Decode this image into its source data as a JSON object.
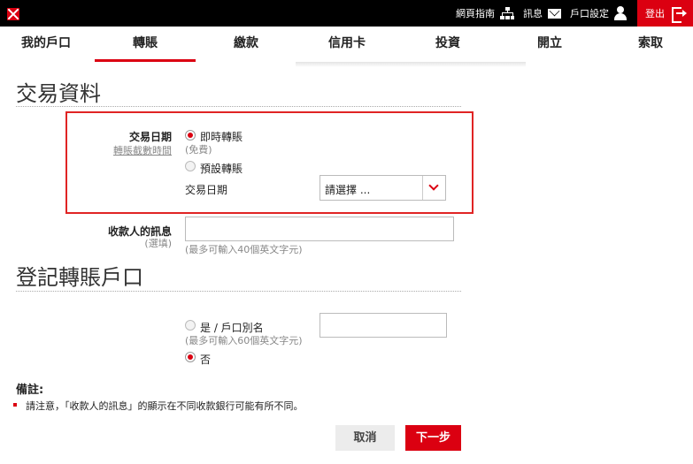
{
  "topbar": {
    "guide": "網頁指南",
    "messages": "訊息",
    "settings": "戶口設定",
    "logout": "登出"
  },
  "nav": {
    "items": [
      "我的戶口",
      "轉賬",
      "繳款",
      "信用卡",
      "投資",
      "開立",
      "索取"
    ],
    "active": "轉賬"
  },
  "transaction": {
    "title": "交易資料",
    "date_label": "交易日期",
    "cutoff_link": "轉賬截數時間",
    "instant_label": "即時轉賬",
    "instant_note": "(免費)",
    "scheduled_label": "預設轉賬",
    "date_sublabel": "交易日期",
    "date_select": "請選擇 ...",
    "message_label": "收款人的訊息",
    "message_optional": "(選填)",
    "message_hint": "(最多可輸入40個英文字元)"
  },
  "register": {
    "title": "登記轉賬戶口",
    "yes_label": "是 / 戶口別名",
    "yes_hint": "(最多可輸入60個英文字元)",
    "no_label": "否"
  },
  "notes": {
    "title": "備註:",
    "items": [
      "請注意，「收款人的訊息」的顯示在不同收款銀行可能有所不同。"
    ]
  },
  "buttons": {
    "cancel": "取消",
    "next": "下一步"
  },
  "colors": {
    "brand_red": "#db0011",
    "highlight_border": "#e02424"
  }
}
